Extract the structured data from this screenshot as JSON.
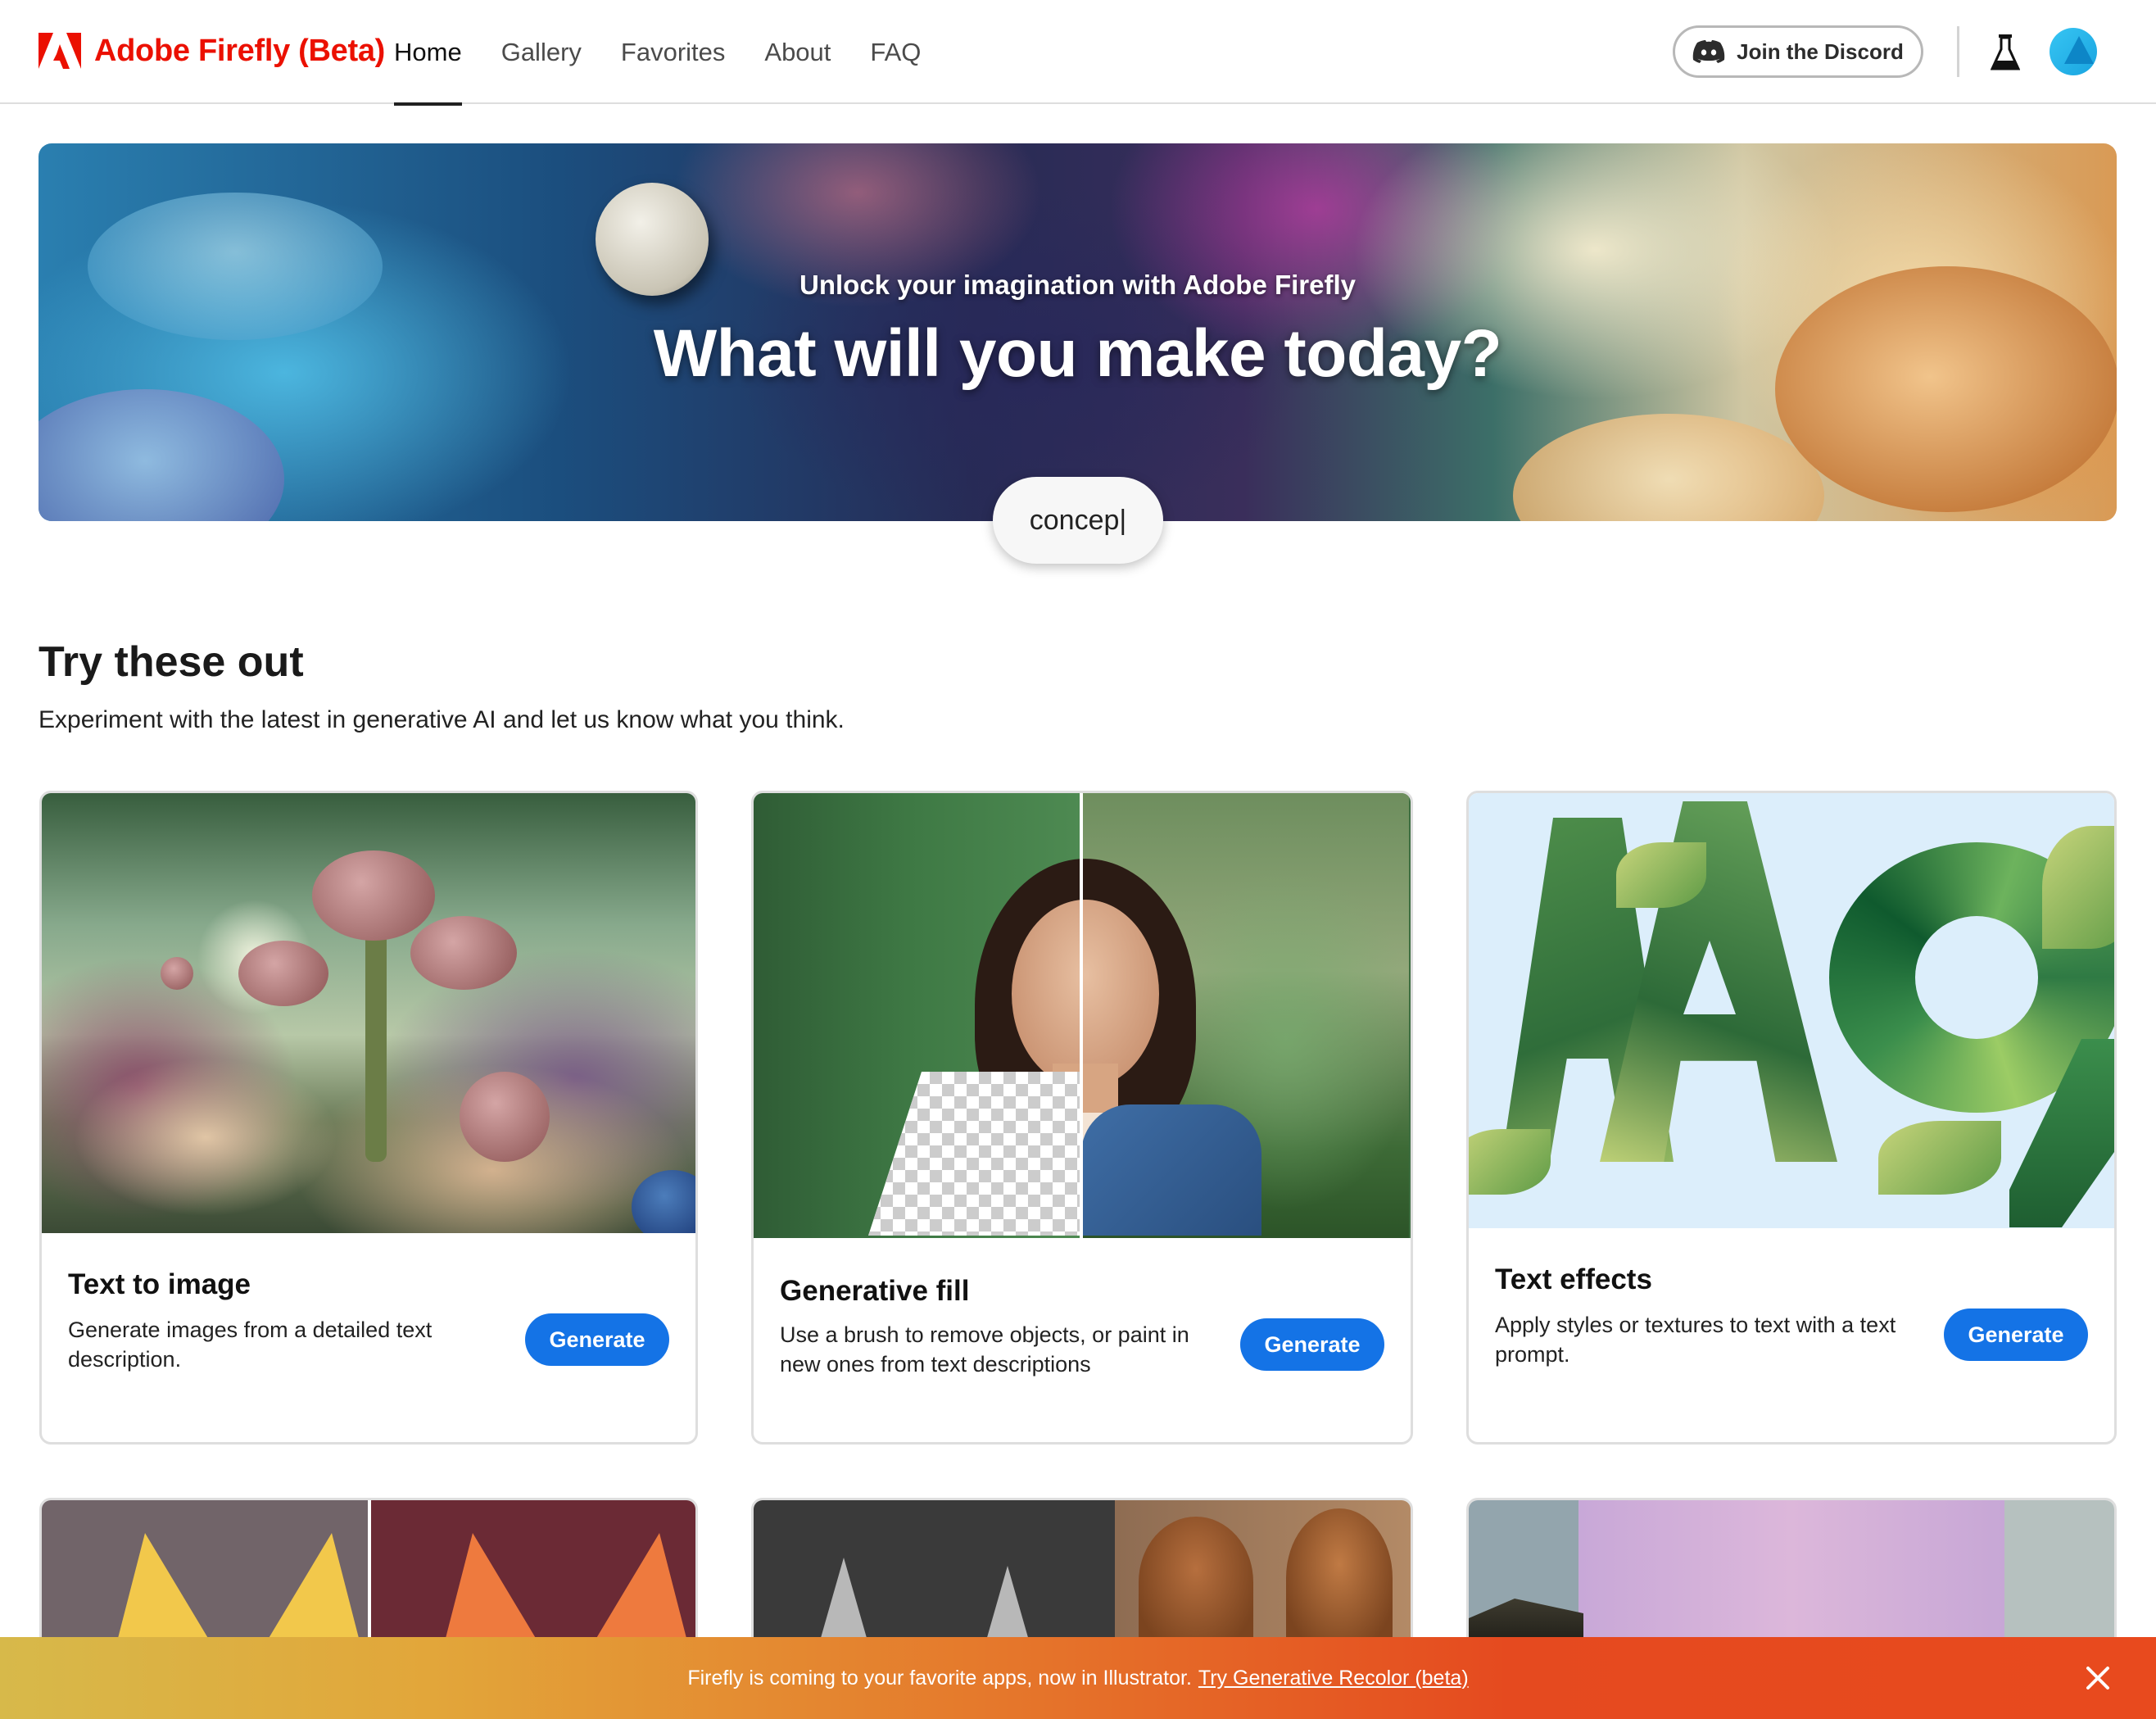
{
  "header": {
    "brand": "Adobe Firefly (Beta)",
    "nav": [
      {
        "label": "Home",
        "active": true
      },
      {
        "label": "Gallery",
        "active": false
      },
      {
        "label": "Favorites",
        "active": false
      },
      {
        "label": "About",
        "active": false
      },
      {
        "label": "FAQ",
        "active": false
      }
    ],
    "discord_button": "Join the Discord",
    "icons": [
      "adobe-logo-icon",
      "discord-icon",
      "labs-flask-icon",
      "avatar"
    ],
    "brand_color": "#eb1000"
  },
  "hero": {
    "subtitle": "Unlock your imagination with Adobe Firefly",
    "title": "What will you make today?",
    "search_value": "concep|"
  },
  "section": {
    "title": "Try these out",
    "subtitle": "Experiment with the latest in generative AI and let us know what you think."
  },
  "cards": [
    {
      "title": "Text to image",
      "description": "Generate images from a detailed text description.",
      "button": "Generate"
    },
    {
      "title": "Generative fill",
      "description": "Use a brush to remove objects, or paint in new ones from text descriptions",
      "button": "Generate"
    },
    {
      "title": "Text effects",
      "description": "Apply styles or textures to text with a text prompt.",
      "button": "Generate"
    }
  ],
  "accent_color": "#1473e6",
  "banner": {
    "text": "Firefly is coming to your favorite apps, now in Illustrator.",
    "link": "Try Generative Recolor (beta)"
  }
}
